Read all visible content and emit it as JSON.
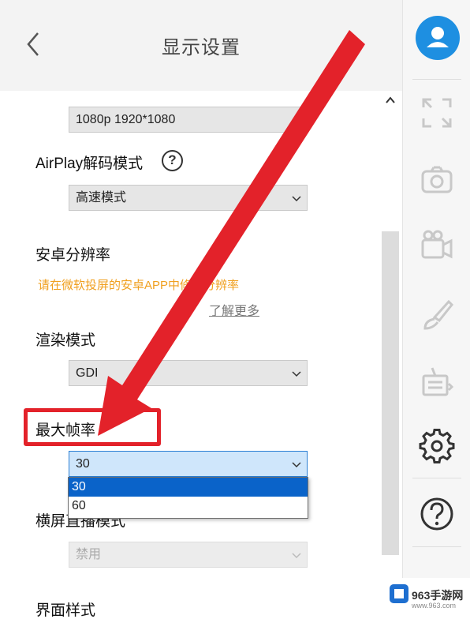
{
  "header": {
    "title": "显示设置"
  },
  "settings": {
    "resolution_value": "1080p 1920*1080",
    "airplay_label": "AirPlay解码模式",
    "airplay_help": "?",
    "airplay_value": "高速模式",
    "android_res_label": "安卓分辨率",
    "android_res_hint": "请在微软投屏的安卓APP中修改分辨率",
    "learn_more": "了解更多",
    "render_label": "渲染模式",
    "render_value": "GDI",
    "fps_label": "最大帧率",
    "fps_value": "30",
    "fps_options": [
      "30",
      "60"
    ],
    "landscape_label": "横屏直播模式",
    "landscape_value": "禁用",
    "ui_style_label": "界面样式"
  },
  "watermark": {
    "text": "963手游网",
    "url": "www.963.com"
  },
  "colors": {
    "accent": "#1e8fe1",
    "annotation": "#e3222a",
    "warning": "#f0a020",
    "selection": "#0a63c9"
  },
  "icons": [
    "chevron-left-icon",
    "fullscreen-icon",
    "camera-icon",
    "video-record-icon",
    "paintbrush-icon",
    "broadcast-icon",
    "gear-icon",
    "help-icon",
    "user-icon"
  ]
}
